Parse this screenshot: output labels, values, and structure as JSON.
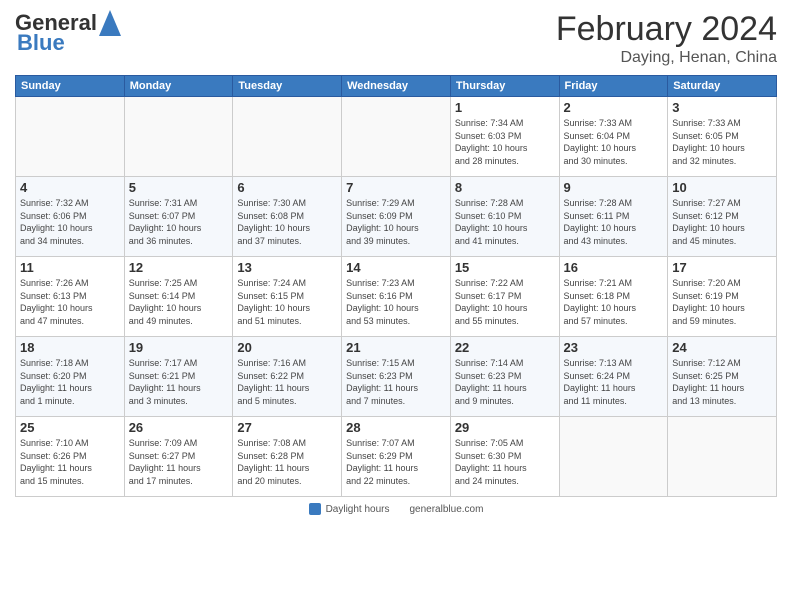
{
  "header": {
    "logo_general": "General",
    "logo_blue": "Blue",
    "title": "February 2024",
    "location": "Daying, Henan, China"
  },
  "days_of_week": [
    "Sunday",
    "Monday",
    "Tuesday",
    "Wednesday",
    "Thursday",
    "Friday",
    "Saturday"
  ],
  "weeks": [
    [
      {
        "day": "",
        "info": ""
      },
      {
        "day": "",
        "info": ""
      },
      {
        "day": "",
        "info": ""
      },
      {
        "day": "",
        "info": ""
      },
      {
        "day": "1",
        "info": "Sunrise: 7:34 AM\nSunset: 6:03 PM\nDaylight: 10 hours\nand 28 minutes."
      },
      {
        "day": "2",
        "info": "Sunrise: 7:33 AM\nSunset: 6:04 PM\nDaylight: 10 hours\nand 30 minutes."
      },
      {
        "day": "3",
        "info": "Sunrise: 7:33 AM\nSunset: 6:05 PM\nDaylight: 10 hours\nand 32 minutes."
      }
    ],
    [
      {
        "day": "4",
        "info": "Sunrise: 7:32 AM\nSunset: 6:06 PM\nDaylight: 10 hours\nand 34 minutes."
      },
      {
        "day": "5",
        "info": "Sunrise: 7:31 AM\nSunset: 6:07 PM\nDaylight: 10 hours\nand 36 minutes."
      },
      {
        "day": "6",
        "info": "Sunrise: 7:30 AM\nSunset: 6:08 PM\nDaylight: 10 hours\nand 37 minutes."
      },
      {
        "day": "7",
        "info": "Sunrise: 7:29 AM\nSunset: 6:09 PM\nDaylight: 10 hours\nand 39 minutes."
      },
      {
        "day": "8",
        "info": "Sunrise: 7:28 AM\nSunset: 6:10 PM\nDaylight: 10 hours\nand 41 minutes."
      },
      {
        "day": "9",
        "info": "Sunrise: 7:28 AM\nSunset: 6:11 PM\nDaylight: 10 hours\nand 43 minutes."
      },
      {
        "day": "10",
        "info": "Sunrise: 7:27 AM\nSunset: 6:12 PM\nDaylight: 10 hours\nand 45 minutes."
      }
    ],
    [
      {
        "day": "11",
        "info": "Sunrise: 7:26 AM\nSunset: 6:13 PM\nDaylight: 10 hours\nand 47 minutes."
      },
      {
        "day": "12",
        "info": "Sunrise: 7:25 AM\nSunset: 6:14 PM\nDaylight: 10 hours\nand 49 minutes."
      },
      {
        "day": "13",
        "info": "Sunrise: 7:24 AM\nSunset: 6:15 PM\nDaylight: 10 hours\nand 51 minutes."
      },
      {
        "day": "14",
        "info": "Sunrise: 7:23 AM\nSunset: 6:16 PM\nDaylight: 10 hours\nand 53 minutes."
      },
      {
        "day": "15",
        "info": "Sunrise: 7:22 AM\nSunset: 6:17 PM\nDaylight: 10 hours\nand 55 minutes."
      },
      {
        "day": "16",
        "info": "Sunrise: 7:21 AM\nSunset: 6:18 PM\nDaylight: 10 hours\nand 57 minutes."
      },
      {
        "day": "17",
        "info": "Sunrise: 7:20 AM\nSunset: 6:19 PM\nDaylight: 10 hours\nand 59 minutes."
      }
    ],
    [
      {
        "day": "18",
        "info": "Sunrise: 7:18 AM\nSunset: 6:20 PM\nDaylight: 11 hours\nand 1 minute."
      },
      {
        "day": "19",
        "info": "Sunrise: 7:17 AM\nSunset: 6:21 PM\nDaylight: 11 hours\nand 3 minutes."
      },
      {
        "day": "20",
        "info": "Sunrise: 7:16 AM\nSunset: 6:22 PM\nDaylight: 11 hours\nand 5 minutes."
      },
      {
        "day": "21",
        "info": "Sunrise: 7:15 AM\nSunset: 6:23 PM\nDaylight: 11 hours\nand 7 minutes."
      },
      {
        "day": "22",
        "info": "Sunrise: 7:14 AM\nSunset: 6:23 PM\nDaylight: 11 hours\nand 9 minutes."
      },
      {
        "day": "23",
        "info": "Sunrise: 7:13 AM\nSunset: 6:24 PM\nDaylight: 11 hours\nand 11 minutes."
      },
      {
        "day": "24",
        "info": "Sunrise: 7:12 AM\nSunset: 6:25 PM\nDaylight: 11 hours\nand 13 minutes."
      }
    ],
    [
      {
        "day": "25",
        "info": "Sunrise: 7:10 AM\nSunset: 6:26 PM\nDaylight: 11 hours\nand 15 minutes."
      },
      {
        "day": "26",
        "info": "Sunrise: 7:09 AM\nSunset: 6:27 PM\nDaylight: 11 hours\nand 17 minutes."
      },
      {
        "day": "27",
        "info": "Sunrise: 7:08 AM\nSunset: 6:28 PM\nDaylight: 11 hours\nand 20 minutes."
      },
      {
        "day": "28",
        "info": "Sunrise: 7:07 AM\nSunset: 6:29 PM\nDaylight: 11 hours\nand 22 minutes."
      },
      {
        "day": "29",
        "info": "Sunrise: 7:05 AM\nSunset: 6:30 PM\nDaylight: 11 hours\nand 24 minutes."
      },
      {
        "day": "",
        "info": ""
      },
      {
        "day": "",
        "info": ""
      }
    ]
  ],
  "footer": {
    "daylight_label": "Daylight hours",
    "source_label": "generalblue.com"
  }
}
